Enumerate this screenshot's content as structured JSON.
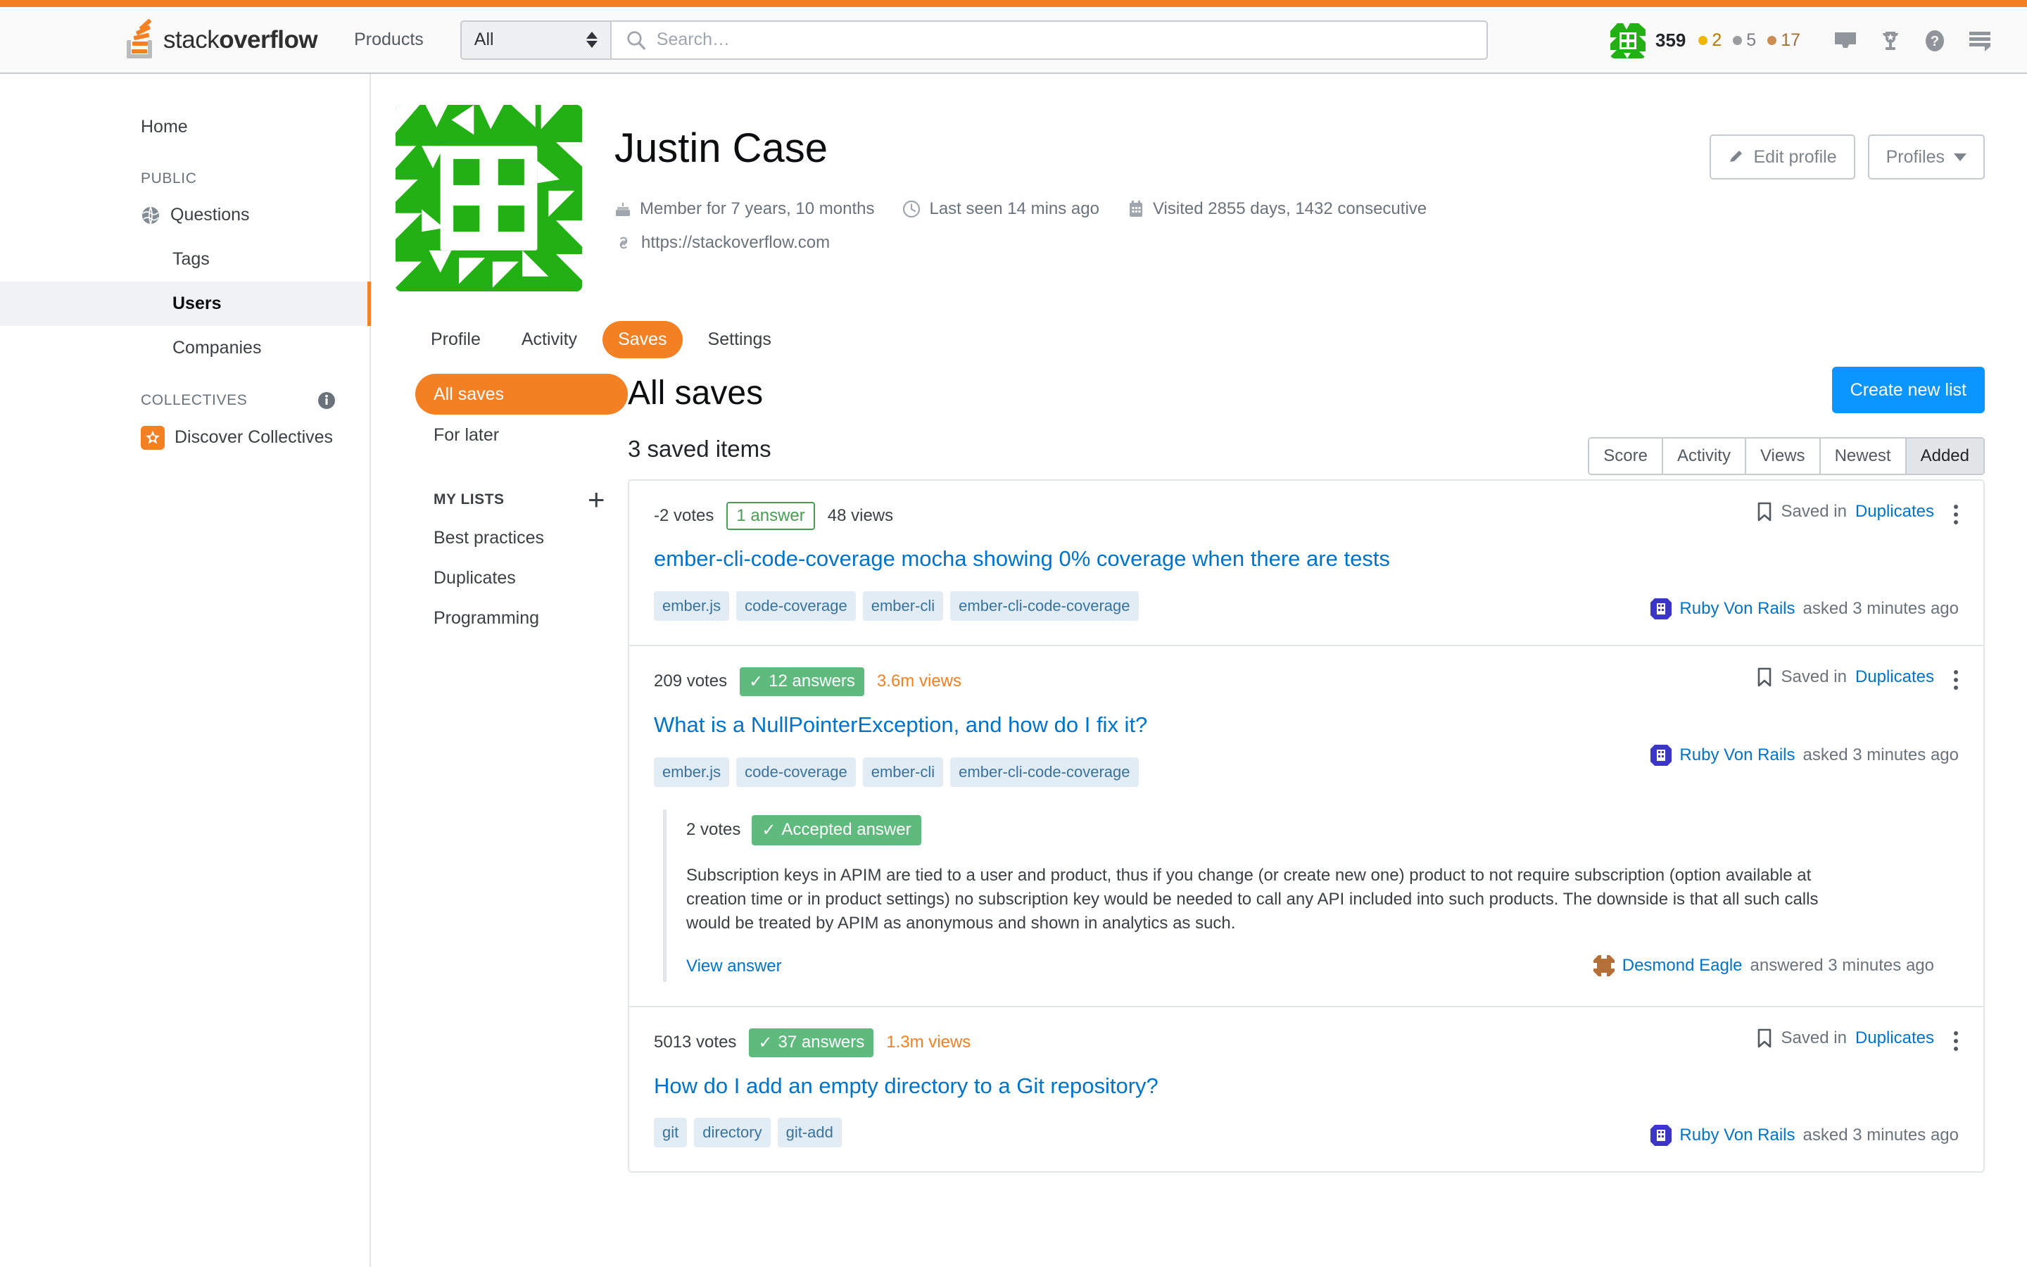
{
  "header": {
    "logo_stack": "stack",
    "logo_overflow": "overflow",
    "products_label": "Products",
    "search_scope": "All",
    "search_placeholder": "Search…",
    "reputation": "359",
    "gold_badges": "2",
    "silver_badges": "5",
    "bronze_badges": "17",
    "icons": [
      "inbox-icon",
      "trophy-icon",
      "help-icon",
      "hamburger-icon"
    ],
    "accent_color": "#f48024"
  },
  "sidebar": {
    "home_label": "Home",
    "public_heading": "PUBLIC",
    "items": [
      {
        "label": "Questions",
        "icon": "globe-icon",
        "active": false
      },
      {
        "label": "Tags",
        "icon": "",
        "active": false
      },
      {
        "label": "Users",
        "icon": "",
        "active": true
      },
      {
        "label": "Companies",
        "icon": "",
        "active": false
      }
    ],
    "collectives_heading": "COLLECTIVES",
    "collectives_info_icon": "info-icon",
    "discover_collectives_label": "Discover Collectives"
  },
  "profile": {
    "name": "Justin Case",
    "avatar_color": "#22b014",
    "member_for": "Member for 7 years, 10 months",
    "last_seen": "Last seen 14 mins ago",
    "visited": "Visited 2855 days, 1432 consecutive",
    "website": "https://stackoverflow.com",
    "edit_profile_label": "Edit profile",
    "profiles_label": "Profiles"
  },
  "tabs": [
    {
      "label": "Profile",
      "active": false
    },
    {
      "label": "Activity",
      "active": false
    },
    {
      "label": "Saves",
      "active": true
    },
    {
      "label": "Settings",
      "active": false
    }
  ],
  "saves_nav": {
    "all_saves_label": "All saves",
    "for_later_label": "For later",
    "my_lists_heading": "MY LISTS",
    "add_list_icon": "plus-icon",
    "lists": [
      "Best practices",
      "Duplicates",
      "Programming"
    ]
  },
  "saves_main": {
    "title": "All saves",
    "count_text": "3 saved items",
    "create_list_label": "Create new list",
    "sort_options": [
      {
        "label": "Score",
        "active": false
      },
      {
        "label": "Activity",
        "active": false
      },
      {
        "label": "Views",
        "active": false
      },
      {
        "label": "Newest",
        "active": false
      },
      {
        "label": "Added",
        "active": true
      }
    ],
    "saved_in_prefix": "Saved in"
  },
  "cards": [
    {
      "votes": "-2 votes",
      "answers": "1 answer",
      "answers_state": "unanswered",
      "views": "48 views",
      "views_state": "normal",
      "title": "ember-cli-code-coverage mocha showing 0% coverage when there are tests",
      "tags": [
        "ember.js",
        "code-coverage",
        "ember-cli",
        "ember-cli-code-coverage"
      ],
      "saved_in_list": "Duplicates",
      "asker": "Ruby Von Rails",
      "asked_text": "asked 3 minutes ago",
      "asker_avatar_color": "#3b36c8"
    },
    {
      "votes": "209 votes",
      "answers": "12 answers",
      "answers_state": "answered",
      "views": "3.6m views",
      "views_state": "warm",
      "title": "What is a NullPointerException, and how do I fix it?",
      "tags": [
        "ember.js",
        "code-coverage",
        "ember-cli",
        "ember-cli-code-coverage"
      ],
      "saved_in_list": "Duplicates",
      "asker": "Ruby Von Rails",
      "asked_text": "asked 3 minutes ago",
      "asker_avatar_color": "#3b36c8",
      "answer": {
        "votes": "2 votes",
        "accepted_label": "Accepted answer",
        "body": "Subscription keys in APIM are tied to a user and product, thus if you change (or create new one) product to not require subscription (option available at creation time or in product settings) no subscription key would be needed to call any API included into such products. The downside is that all such calls would be treated by APIM as anonymous and shown in analytics as such.",
        "view_answer_label": "View answer",
        "answerer": "Desmond Eagle",
        "answered_text": "answered 3 minutes ago",
        "answerer_avatar_color": "#b5703a"
      }
    },
    {
      "votes": "5013 votes",
      "answers": "37 answers",
      "answers_state": "answered",
      "views": "1.3m views",
      "views_state": "warm",
      "title": "How do I add an empty directory to a Git repository?",
      "tags": [
        "git",
        "directory",
        "git-add"
      ],
      "saved_in_list": "Duplicates",
      "asker": "Ruby Von Rails",
      "asked_text": "asked 3 minutes ago",
      "asker_avatar_color": "#3b36c8"
    }
  ]
}
